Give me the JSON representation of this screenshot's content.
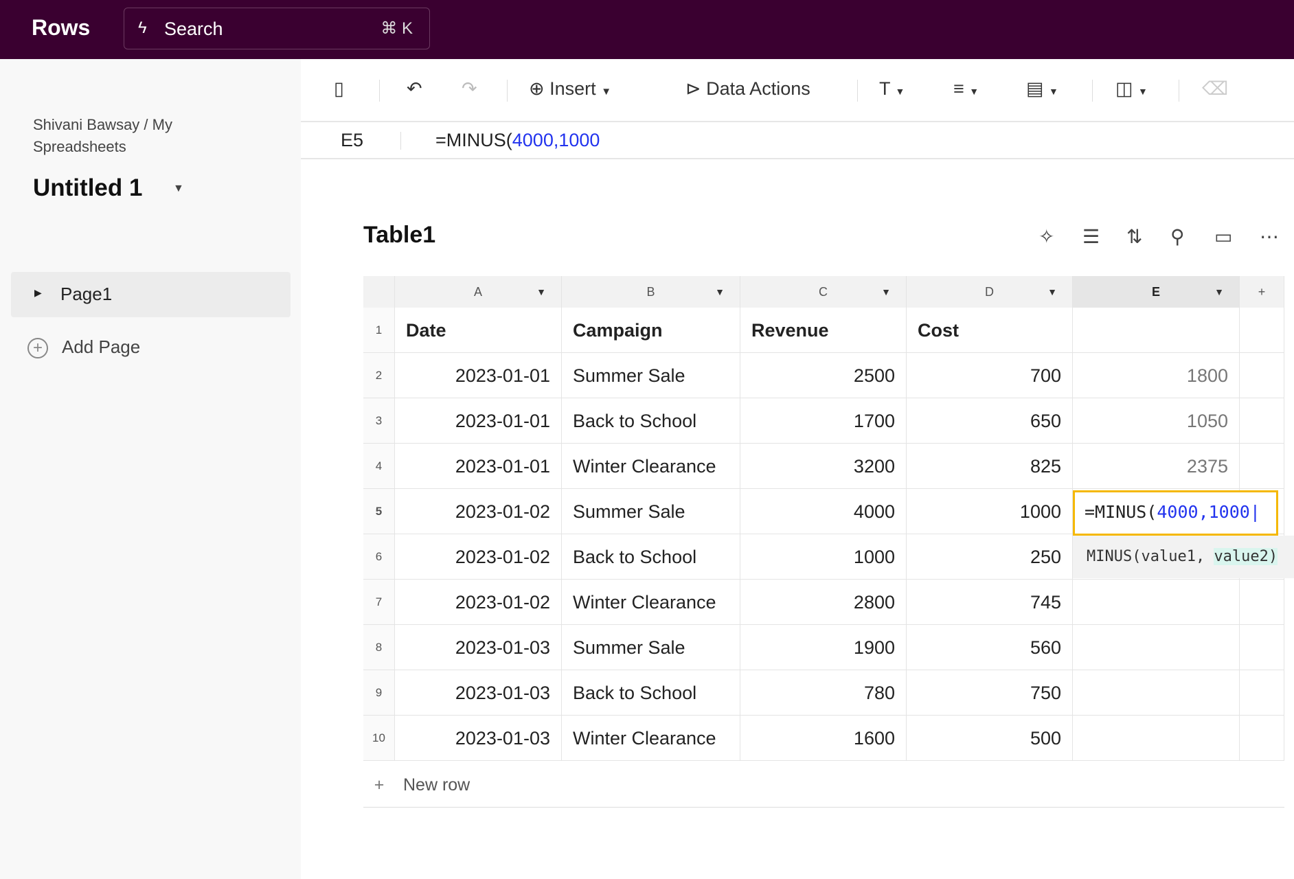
{
  "app": {
    "logo": "Rows",
    "search_placeholder": "Search",
    "search_shortcut": "⌘ K",
    "brand_color": "#3a0030"
  },
  "sidebar": {
    "breadcrumb": "Shivani Bawsay / My Spreadsheets",
    "doc_title": "Untitled 1",
    "pages": [
      {
        "label": "Page1"
      }
    ],
    "add_page": "Add Page"
  },
  "toolbar": {
    "insert": "Insert",
    "data_actions": "Data Actions"
  },
  "formula_bar": {
    "cell_ref": "E5",
    "prefix": "=MINUS(",
    "args": "4000,1000"
  },
  "table": {
    "title": "Table1",
    "columns": [
      "A",
      "B",
      "C",
      "D",
      "E"
    ],
    "headers": [
      "Date",
      "Campaign",
      "Revenue",
      "Cost",
      ""
    ],
    "rows": [
      [
        "2023-01-01",
        "Summer Sale",
        "2500",
        "700",
        "1800"
      ],
      [
        "2023-01-01",
        "Back to School",
        "1700",
        "650",
        "1050"
      ],
      [
        "2023-01-01",
        "Winter Clearance",
        "3200",
        "825",
        "2375"
      ],
      [
        "2023-01-02",
        "Summer Sale",
        "4000",
        "1000",
        ""
      ],
      [
        "2023-01-02",
        "Back to School",
        "1000",
        "250",
        ""
      ],
      [
        "2023-01-02",
        "Winter Clearance",
        "2800",
        "745",
        ""
      ],
      [
        "2023-01-03",
        "Summer Sale",
        "1900",
        "560",
        ""
      ],
      [
        "2023-01-03",
        "Back to School",
        "780",
        "750",
        ""
      ],
      [
        "2023-01-03",
        "Winter Clearance",
        "1600",
        "500",
        ""
      ]
    ],
    "new_row": "New row",
    "selected_cell": "E5"
  },
  "editor": {
    "prefix": "=MINUS(",
    "args": "4000,1000",
    "hint_fn": "MINUS(value1, ",
    "hint_active": "value2)"
  }
}
